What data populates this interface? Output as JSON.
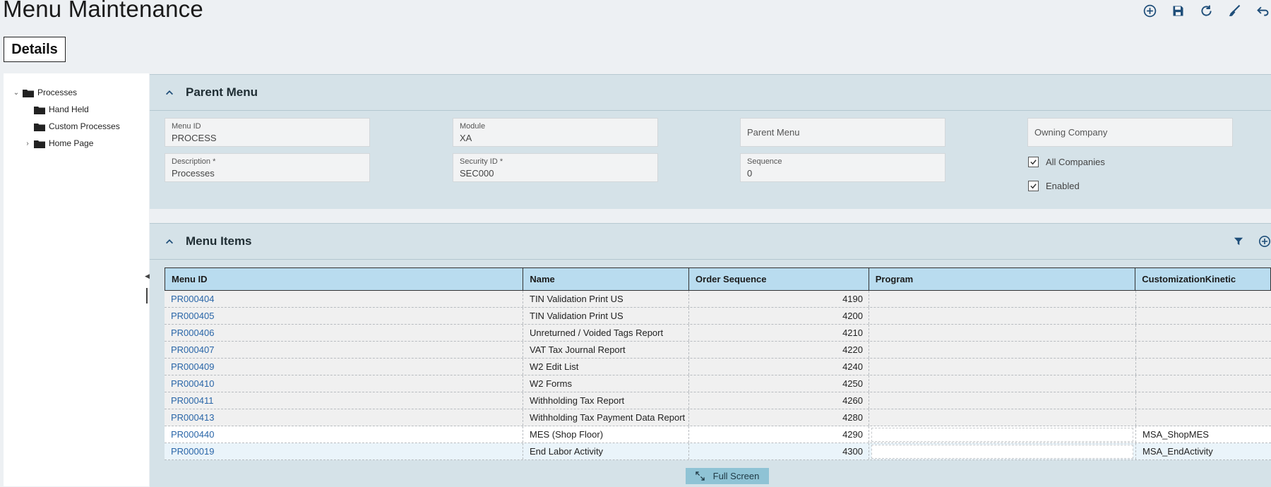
{
  "page_title": "Menu Maintenance",
  "toolbar": {
    "icons": [
      "add-new-icon",
      "save-icon",
      "refresh-icon",
      "clear-icon",
      "undo-icon"
    ]
  },
  "tabs": {
    "details": "Details"
  },
  "tree": {
    "items": [
      {
        "label": "Processes",
        "expanded": true
      },
      {
        "label": "Hand Held"
      },
      {
        "label": "Custom Processes"
      },
      {
        "label": "Home Page",
        "expanded": false
      }
    ]
  },
  "parent_menu": {
    "title": "Parent Menu",
    "menu_id_label": "Menu ID",
    "menu_id_value": "PROCESS",
    "module_label": "Module",
    "module_value": "XA",
    "parent_menu_placeholder": "Parent Menu",
    "owning_company_placeholder": "Owning Company",
    "description_label": "Description *",
    "description_value": "Processes",
    "security_id_label": "Security ID *",
    "security_id_value": "SEC000",
    "sequence_label": "Sequence",
    "sequence_value": "0",
    "all_companies_label": "All Companies",
    "all_companies_checked": true,
    "enabled_label": "Enabled",
    "enabled_checked": true
  },
  "menu_items": {
    "title": "Menu Items",
    "columns": [
      "Menu ID",
      "Name",
      "Order Sequence",
      "Program",
      "CustomizationKinetic"
    ],
    "rows": [
      {
        "id": "PR000404",
        "name": "TIN Validation Print US",
        "seq": "4190",
        "program": "",
        "custom": ""
      },
      {
        "id": "PR000405",
        "name": "TIN Validation Print US",
        "seq": "4200",
        "program": "",
        "custom": ""
      },
      {
        "id": "PR000406",
        "name": "Unreturned / Voided Tags Report",
        "seq": "4210",
        "program": "",
        "custom": ""
      },
      {
        "id": "PR000407",
        "name": "VAT Tax Journal Report",
        "seq": "4220",
        "program": "",
        "custom": ""
      },
      {
        "id": "PR000409",
        "name": "W2 Edit List",
        "seq": "4240",
        "program": "",
        "custom": ""
      },
      {
        "id": "PR000410",
        "name": "W2 Forms",
        "seq": "4250",
        "program": "",
        "custom": ""
      },
      {
        "id": "PR000411",
        "name": "Withholding Tax Report",
        "seq": "4260",
        "program": "",
        "custom": ""
      },
      {
        "id": "PR000413",
        "name": "Withholding Tax Payment Data Report",
        "seq": "4280",
        "program": "",
        "custom": ""
      },
      {
        "id": "PR000440",
        "name": "MES (Shop Floor)",
        "seq": "4290",
        "program": "",
        "custom": "MSA_ShopMES"
      },
      {
        "id": "PR000019",
        "name": "End Labor Activity",
        "seq": "4300",
        "program": "",
        "custom": "MSA_EndActivity"
      }
    ]
  },
  "full_screen_label": "Full Screen",
  "colors": {
    "section_bg": "#d5e2e8",
    "grid_header": "#b9dcef",
    "link": "#2a66a8",
    "button": "#8fc3d5"
  }
}
